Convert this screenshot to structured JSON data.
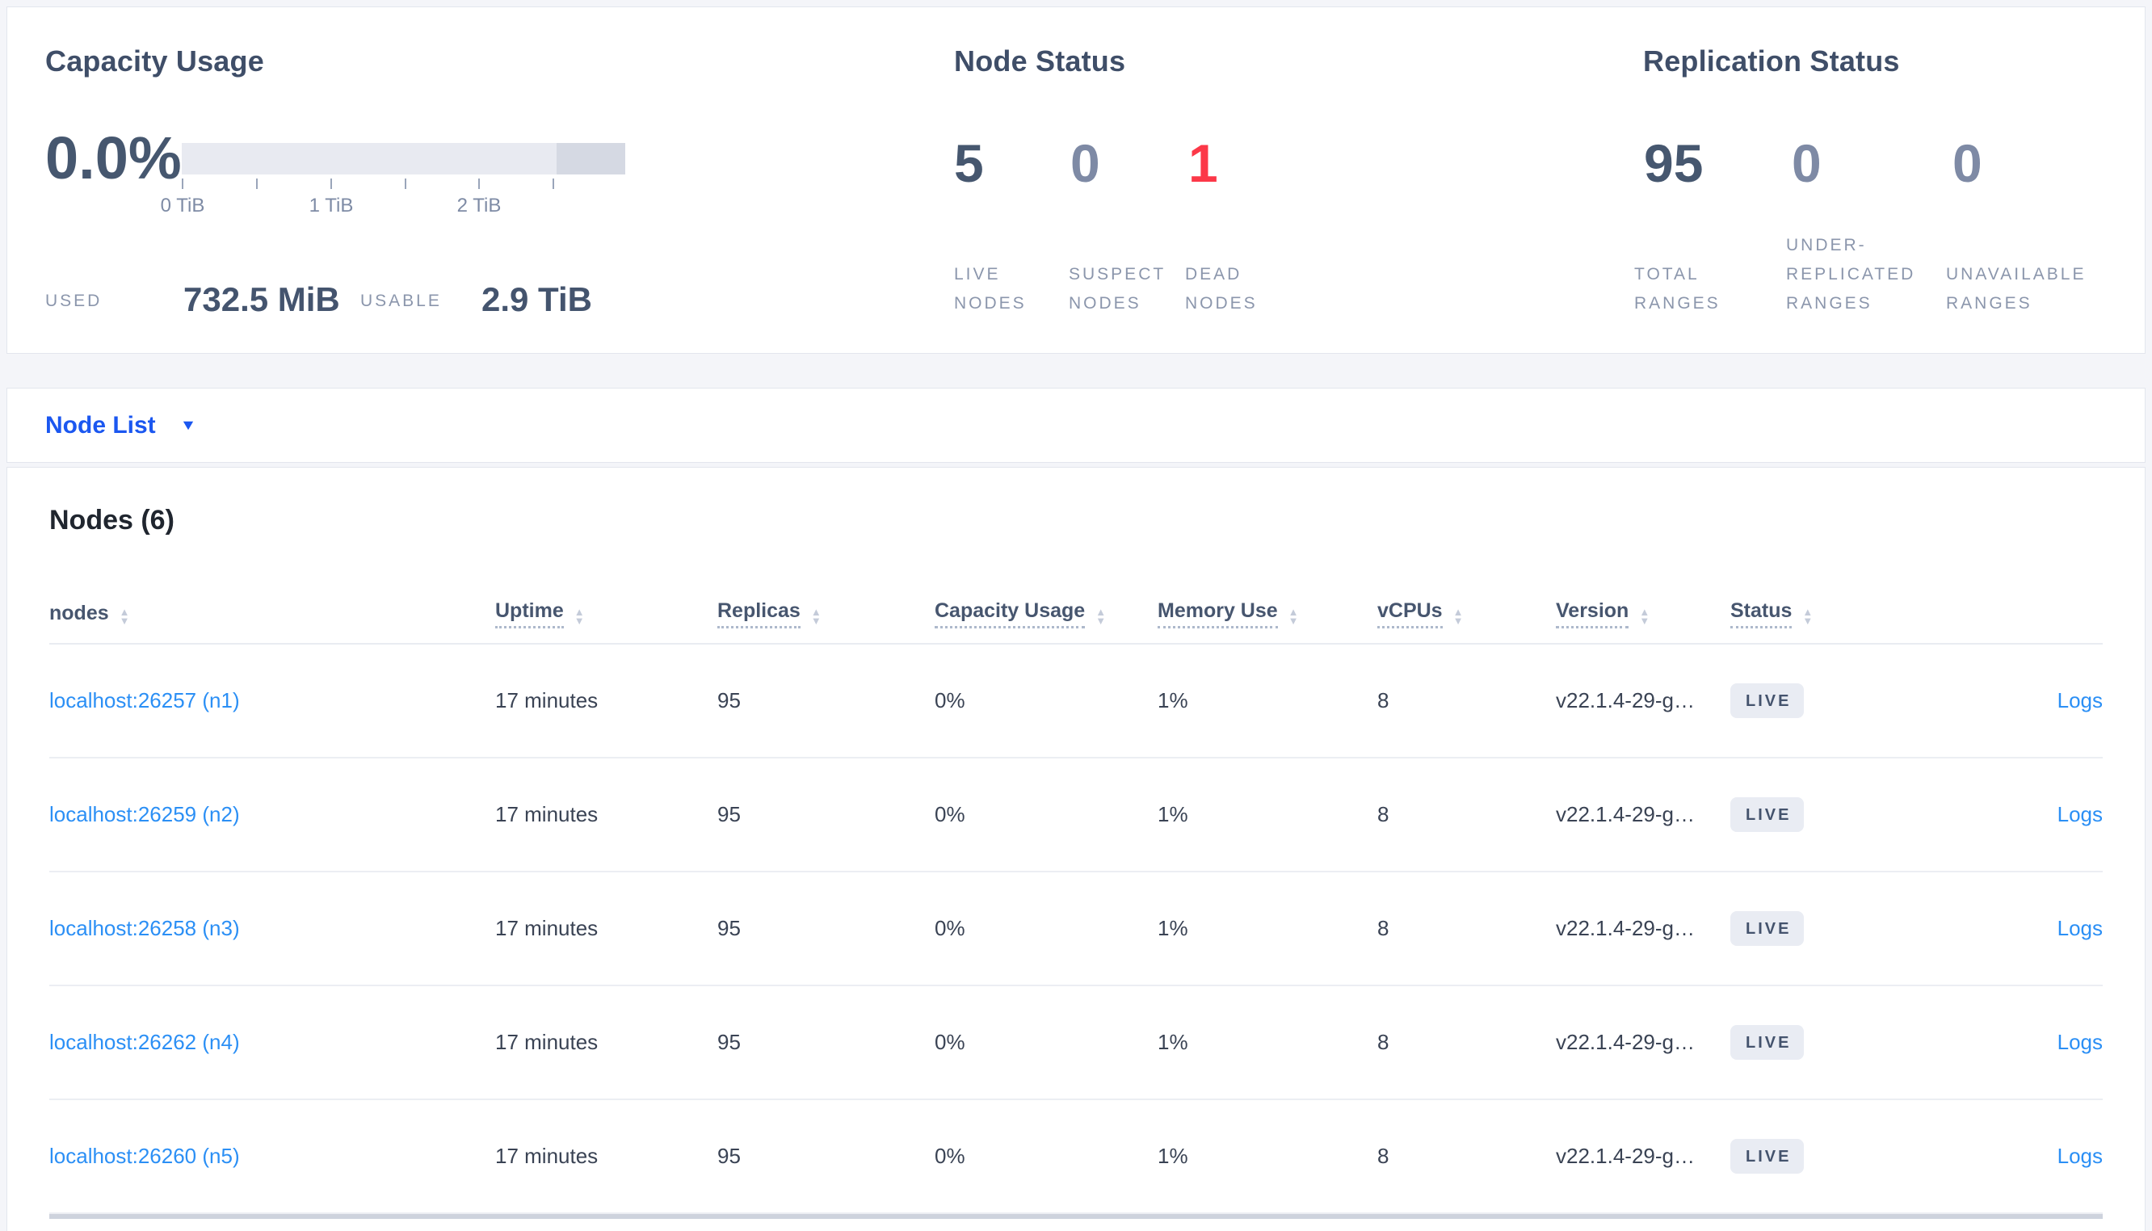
{
  "colors": {
    "accent_blue": "#1b57f0",
    "link_blue": "#2b8ff5",
    "dead_red": "#fc3848",
    "dark_slate": "#46576f",
    "muted_label": "#8b96ac",
    "badge_bg": "#e9ecf3"
  },
  "capacity_panel": {
    "title": "Capacity Usage",
    "percent": "0.0%",
    "tick_labels": [
      "0 TiB",
      "1 TiB",
      "2 TiB"
    ],
    "used_label": "USED",
    "used_value": "732.5 MiB",
    "usable_label": "USABLE",
    "usable_value": "2.9 TiB"
  },
  "node_status_panel": {
    "title": "Node Status",
    "stats": [
      {
        "value": "5",
        "lines": [
          "LIVE",
          "NODES"
        ]
      },
      {
        "value": "0",
        "lines": [
          "SUSPECT",
          "NODES"
        ]
      },
      {
        "value": "1",
        "lines": [
          "DEAD",
          "NODES"
        ]
      }
    ]
  },
  "replication_panel": {
    "title": "Replication Status",
    "stats": [
      {
        "value": "95",
        "lines": [
          "TOTAL",
          "RANGES"
        ]
      },
      {
        "value": "0",
        "lines": [
          "UNDER-",
          "REPLICATED",
          "RANGES"
        ]
      },
      {
        "value": "0",
        "lines": [
          "UNAVAILABLE",
          "RANGES"
        ]
      }
    ]
  },
  "node_list_bar": {
    "label": "Node List",
    "caret_icon": "▼"
  },
  "nodes_section": {
    "title": "Nodes (6)",
    "columns": [
      {
        "label": "nodes"
      },
      {
        "label": "Uptime"
      },
      {
        "label": "Replicas"
      },
      {
        "label": "Capacity Usage"
      },
      {
        "label": "Memory Use"
      },
      {
        "label": "vCPUs"
      },
      {
        "label": "Version"
      },
      {
        "label": "Status"
      }
    ],
    "rows": [
      {
        "name": "localhost:26257 (n1)",
        "uptime": "17 minutes",
        "replicas": "95",
        "capacity": "0%",
        "memory": "1%",
        "vcpus": "8",
        "version": "v22.1.4-29-g…",
        "status": "LIVE",
        "logs": "Logs"
      },
      {
        "name": "localhost:26259 (n2)",
        "uptime": "17 minutes",
        "replicas": "95",
        "capacity": "0%",
        "memory": "1%",
        "vcpus": "8",
        "version": "v22.1.4-29-g…",
        "status": "LIVE",
        "logs": "Logs"
      },
      {
        "name": "localhost:26258 (n3)",
        "uptime": "17 minutes",
        "replicas": "95",
        "capacity": "0%",
        "memory": "1%",
        "vcpus": "8",
        "version": "v22.1.4-29-g…",
        "status": "LIVE",
        "logs": "Logs"
      },
      {
        "name": "localhost:26262 (n4)",
        "uptime": "17 minutes",
        "replicas": "95",
        "capacity": "0%",
        "memory": "1%",
        "vcpus": "8",
        "version": "v22.1.4-29-g…",
        "status": "LIVE",
        "logs": "Logs"
      },
      {
        "name": "localhost:26260 (n5)",
        "uptime": "17 minutes",
        "replicas": "95",
        "capacity": "0%",
        "memory": "1%",
        "vcpus": "8",
        "version": "v22.1.4-29-g…",
        "status": "LIVE",
        "logs": "Logs"
      }
    ]
  }
}
